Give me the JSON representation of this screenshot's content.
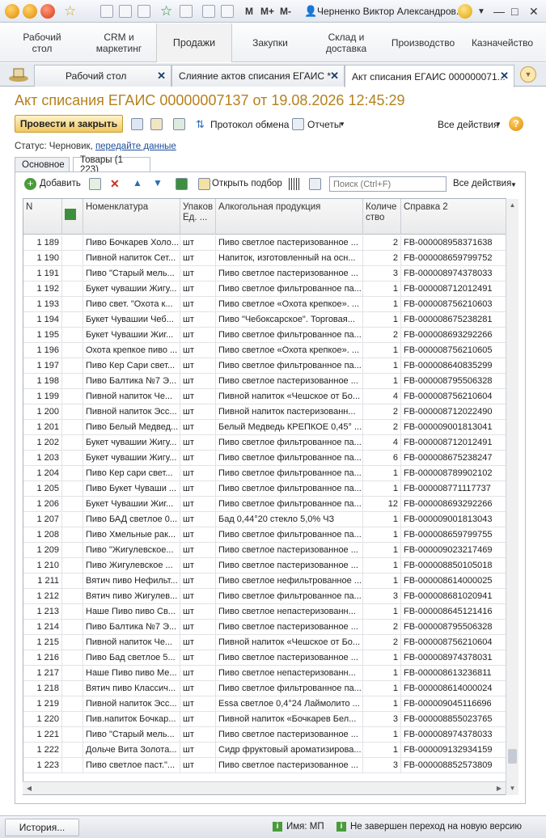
{
  "app": {
    "user": "Черненко Виктор Александров...",
    "memory_buttons": [
      "M",
      "M+",
      "M-"
    ]
  },
  "sections": [
    {
      "label": "Рабочий\nстол"
    },
    {
      "label": "CRM и\nмаркетинг"
    },
    {
      "label": "Продажи"
    },
    {
      "label": "Закупки"
    },
    {
      "label": "Склад и\nдоставка"
    },
    {
      "label": "Производство"
    },
    {
      "label": "Казначейство"
    }
  ],
  "tabs": [
    {
      "label": "Рабочий стол"
    },
    {
      "label": "Слияние актов списания ЕГАИС *"
    },
    {
      "label": "Акт списания ЕГАИС 000000071..."
    }
  ],
  "document": {
    "title": "Акт списания ЕГАИС 00000007137 от 19.08.2026 12:45:29",
    "post_close": "Провести и закрыть",
    "protocol": "Протокол обмена",
    "reports": "Отчеты",
    "all_actions": "Все действия",
    "help": "?",
    "status_label": "Статус:",
    "status_value": "Черновик,",
    "status_link": "передайте данные"
  },
  "subtabs": [
    {
      "label": "Основное"
    },
    {
      "label": "Товары (1 223)"
    }
  ],
  "table_toolbar": {
    "add": "Добавить",
    "open_selection": "Открыть подбор",
    "search_placeholder": "Поиск (Ctrl+F)",
    "all_actions": "Все действия"
  },
  "columns": [
    "N",
    "",
    "Номенклатура",
    "Упаков Ед. ...",
    "Алкогольная продукция",
    "Количе ство",
    "Справка 2"
  ],
  "rows": [
    [
      "1 189",
      "Пиво Бочкарев Холо...",
      "шт",
      "Пиво светлое пастеризованное ...",
      "2",
      "FB-000008958371638"
    ],
    [
      "1 190",
      "Пивной напиток Сет...",
      "шт",
      "Напиток, изготовленный на осн...",
      "2",
      "FB-000008659799752"
    ],
    [
      "1 191",
      "Пиво \"Старый мель...",
      "шт",
      "Пиво светлое пастеризованное ...",
      "3",
      "FB-000008974378033"
    ],
    [
      "1 192",
      "Букет чувашии Жигу...",
      "шт",
      "Пиво светлое фильтрованное па...",
      "1",
      "FB-000008712012491"
    ],
    [
      "1 193",
      "Пиво свет. \"Охота к...",
      "шт",
      "Пиво светлое «Охота крепкое». ...",
      "1",
      "FB-000008756210603"
    ],
    [
      "1 194",
      "Букет Чувашии Чеб...",
      "шт",
      "Пиво \"Чебоксарское\". Торговая...",
      "1",
      "FB-000008675238281"
    ],
    [
      "1 195",
      "Букет Чувашии Жиг...",
      "шт",
      "Пиво светлое фильтрованное па...",
      "2",
      "FB-000008693292266"
    ],
    [
      "1 196",
      "Охота крепкое пиво ...",
      "шт",
      "Пиво светлое «Охота крепкое». ...",
      "1",
      "FB-000008756210605"
    ],
    [
      "1 197",
      "Пиво Кер Сари свет...",
      "шт",
      "Пиво светлое фильтрованное па...",
      "1",
      "FB-000008640835299"
    ],
    [
      "1 198",
      "Пиво Балтика №7 Э...",
      "шт",
      "Пиво светлое пастеризованное ...",
      "1",
      "FB-000008795506328"
    ],
    [
      "1 199",
      "Пивной напиток Че...",
      "шт",
      "Пивной напиток «Чешское от Бо...",
      "4",
      "FB-000008756210604"
    ],
    [
      "1 200",
      "Пивной напиток Эсс...",
      "шт",
      "Пивной напиток пастеризованн...",
      "2",
      "FB-000008712022490"
    ],
    [
      "1 201",
      "Пиво Белый Медвед...",
      "шт",
      "Белый Медведь КРЕПКОЕ 0,45° ...",
      "2",
      "FB-000009001813041"
    ],
    [
      "1 202",
      "Букет чувашии Жигу...",
      "шт",
      "Пиво светлое фильтрованное па...",
      "4",
      "FB-000008712012491"
    ],
    [
      "1 203",
      "Букет чувашии Жигу...",
      "шт",
      "Пиво светлое фильтрованное па...",
      "6",
      "FB-000008675238247"
    ],
    [
      "1 204",
      "Пиво Кер сари свет...",
      "шт",
      "Пиво светлое фильтрованное па...",
      "1",
      "FB-000008789902102"
    ],
    [
      "1 205",
      "Пиво Букет Чуваши ...",
      "шт",
      "Пиво светлое фильтрованное па...",
      "1",
      "FB-000008771117737"
    ],
    [
      "1 206",
      "Букет Чувашии Жиг...",
      "шт",
      "Пиво светлое фильтрованное па...",
      "12",
      "FB-000008693292266"
    ],
    [
      "1 207",
      "Пиво БАД светлое 0...",
      "шт",
      "Бад 0,44°20 стекло 5,0%  ЧЗ",
      "1",
      "FB-000009001813043"
    ],
    [
      "1 208",
      "Пиво Хмельные рак...",
      "шт",
      "Пиво светлое фильтрованное па...",
      "1",
      "FB-000008659799755"
    ],
    [
      "1 209",
      "Пиво \"Жигулевское...",
      "шт",
      "Пиво светлое пастеризованное ...",
      "1",
      "FB-000009023217469"
    ],
    [
      "1 210",
      "Пиво Жигулевское ...",
      "шт",
      "Пиво светлое пастеризованное ...",
      "1",
      "FB-000008850105018"
    ],
    [
      "1 211",
      "Вятич пиво Нефильт...",
      "шт",
      "Пиво светлое нефильтрованное ...",
      "1",
      "FB-000008614000025"
    ],
    [
      "1 212",
      "Вятич пиво Жигулев...",
      "шт",
      "Пиво светлое фильтрованное па...",
      "3",
      "FB-000008681020941"
    ],
    [
      "1 213",
      "Наше Пиво пиво Св...",
      "шт",
      "Пиво светлое непастеризованн...",
      "1",
      "FB-000008645121416"
    ],
    [
      "1 214",
      "Пиво Балтика №7 Э...",
      "шт",
      "Пиво светлое пастеризованное ...",
      "2",
      "FB-000008795506328"
    ],
    [
      "1 215",
      "Пивной напиток Че...",
      "шт",
      "Пивной напиток «Чешское от Бо...",
      "2",
      "FB-000008756210604"
    ],
    [
      "1 216",
      "Пиво Бад светлое 5...",
      "шт",
      "Пиво светлое пастеризованное ...",
      "1",
      "FB-000008974378031"
    ],
    [
      "1 217",
      "Наше Пиво пиво Ме...",
      "шт",
      "Пиво светлое непастеризованн...",
      "1",
      "FB-000008613236811"
    ],
    [
      "1 218",
      "Вятич пиво Классич...",
      "шт",
      "Пиво светлое фильтрованное па...",
      "1",
      "FB-000008614000024"
    ],
    [
      "1 219",
      "Пивной напиток Эсс...",
      "шт",
      "Essa светлое 0,4°24 Лаймолито ...",
      "1",
      "FB-000009045116696"
    ],
    [
      "1 220",
      "Пив.напиток Бочкар...",
      "шт",
      "Пивной напиток «Бочкарев Бел...",
      "3",
      "FB-000008855023765"
    ],
    [
      "1 221",
      "Пиво \"Старый мель...",
      "шт",
      "Пиво светлое пастеризованное ...",
      "1",
      "FB-000008974378033"
    ],
    [
      "1 222",
      "Дольче Вита Золота...",
      "шт",
      "Сидр фруктовый ароматизирова...",
      "1",
      "FB-000009132934159"
    ],
    [
      "1 223",
      "Пиво светлое паст.\"...",
      "шт",
      "Пиво светлое пастеризованное ...",
      "3",
      "FB-000008852573809"
    ]
  ],
  "footer": {
    "history": "История...",
    "name_label": "Имя: МП",
    "version_notice": "Не завершен переход на новую версию"
  }
}
